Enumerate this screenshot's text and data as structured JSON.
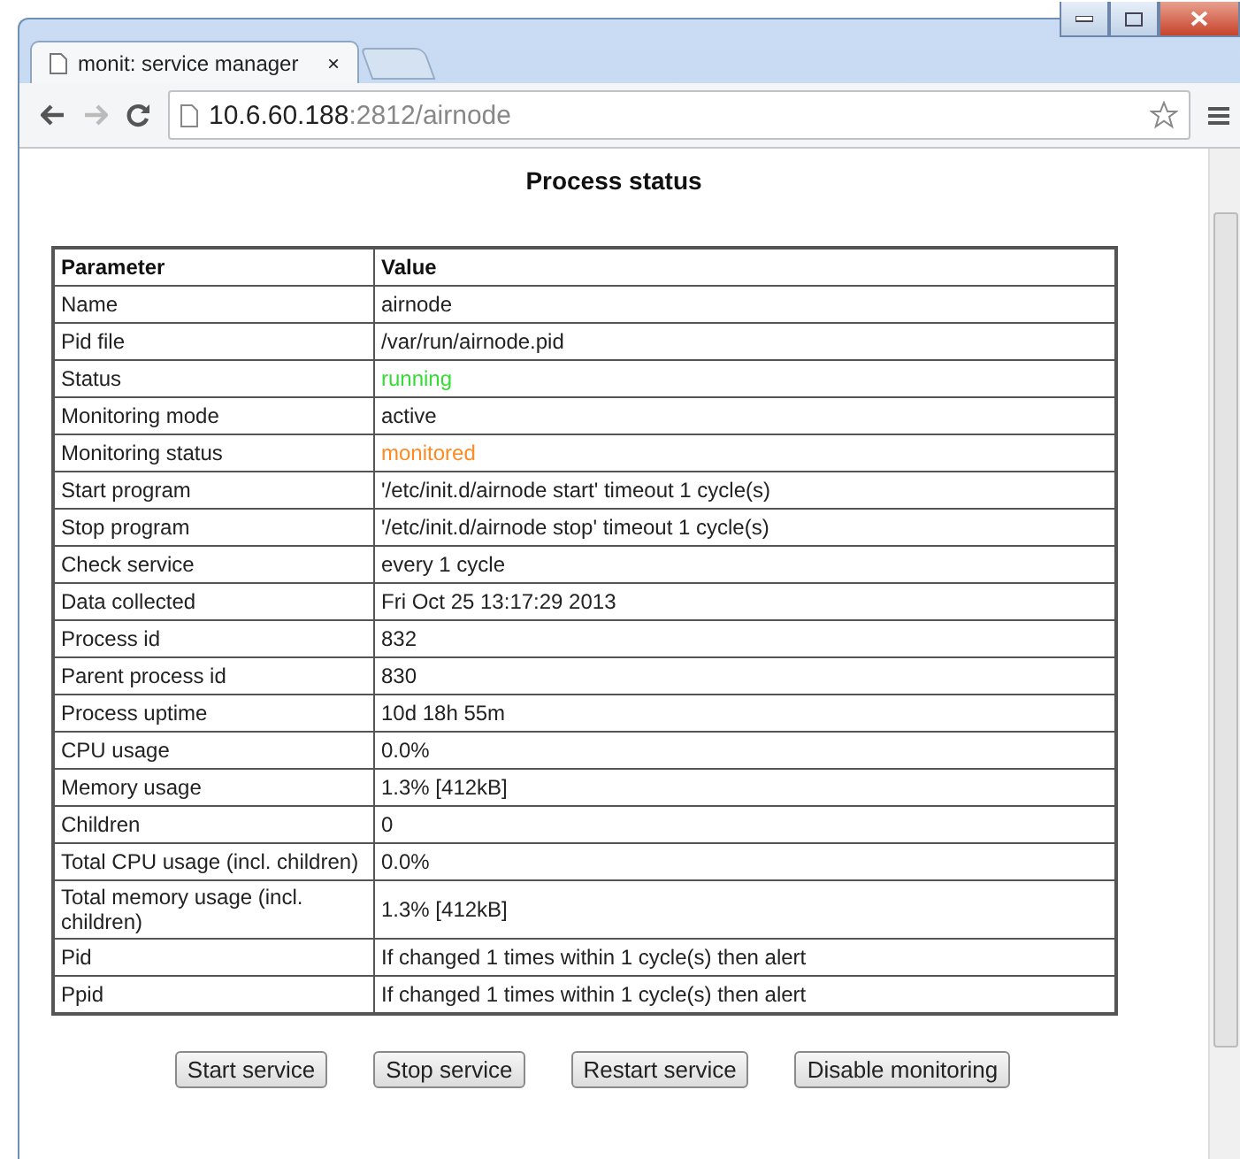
{
  "tabs": [
    {
      "label": "monit: service manager",
      "close": "×",
      "selected": true
    }
  ],
  "address": {
    "host": "10.6.60.188",
    "rest": ":2812/airnode"
  },
  "page_title": "Process status",
  "table": {
    "columns": [
      "Parameter",
      "Value"
    ],
    "rows": [
      {
        "parameter": "Name",
        "value": "airnode"
      },
      {
        "parameter": "Pid file",
        "value": "/var/run/airnode.pid"
      },
      {
        "parameter": "Status",
        "value": "running",
        "color": "#33dd33"
      },
      {
        "parameter": "Monitoring mode",
        "value": "active"
      },
      {
        "parameter": "Monitoring status",
        "value": "monitored",
        "color": "#ff8a22"
      },
      {
        "parameter": "Start program",
        "value": "'/etc/init.d/airnode start' timeout 1 cycle(s)"
      },
      {
        "parameter": "Stop program",
        "value": "'/etc/init.d/airnode stop' timeout 1 cycle(s)"
      },
      {
        "parameter": "Check service",
        "value": "every 1 cycle"
      },
      {
        "parameter": "Data collected",
        "value": "Fri Oct 25 13:17:29 2013"
      },
      {
        "parameter": "Process id",
        "value": "832"
      },
      {
        "parameter": "Parent process id",
        "value": "830"
      },
      {
        "parameter": "Process uptime",
        "value": "10d 18h 55m"
      },
      {
        "parameter": "CPU usage",
        "value": "0.0%"
      },
      {
        "parameter": "Memory usage",
        "value": "1.3% [412kB]"
      },
      {
        "parameter": "Children",
        "value": "0"
      },
      {
        "parameter": "Total CPU usage (incl. children)",
        "value": "0.0%"
      },
      {
        "parameter": "Total memory usage (incl. children)",
        "value": "1.3% [412kB]"
      },
      {
        "parameter": "Pid",
        "value": "If changed 1 times within 1 cycle(s) then alert"
      },
      {
        "parameter": "Ppid",
        "value": "If changed 1 times within 1 cycle(s) then alert"
      }
    ]
  },
  "buttons": [
    "Start service",
    "Stop service",
    "Restart service",
    "Disable monitoring"
  ]
}
